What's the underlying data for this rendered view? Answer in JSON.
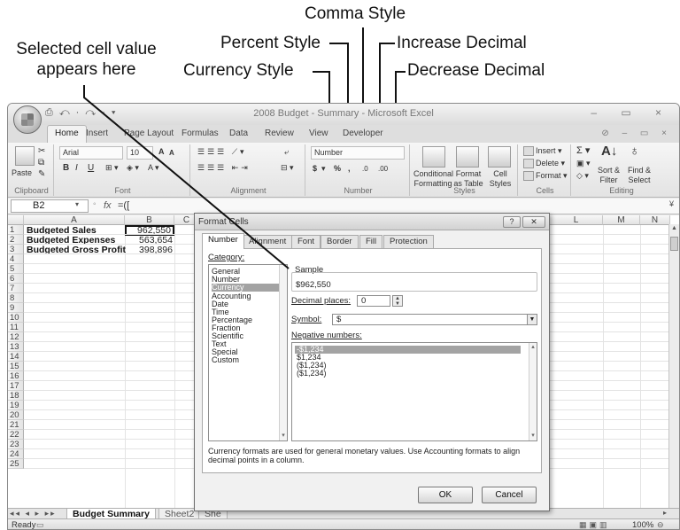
{
  "callouts": {
    "selected_cell": [
      "Selected cell value",
      "appears here"
    ],
    "comma_style": "Comma Style",
    "percent_style": "Percent Style",
    "increase_decimal": "Increase Decimal",
    "currency_style": "Currency Style",
    "decrease_decimal": "Decrease Decimal"
  },
  "window": {
    "title": "2008 Budget - Summary - Microsoft Excel",
    "quick_access": "⎙ ↶ · ↷ · ▾",
    "controls": "– ▭ ×",
    "help_controls": "⊘ – ▭ ×"
  },
  "tabs": [
    "Home",
    "Insert",
    "Page Layout",
    "Formulas",
    "Data",
    "Review",
    "View",
    "Developer"
  ],
  "ribbon": {
    "clipboard": {
      "label": "Clipboard",
      "paste": "Paste"
    },
    "font": {
      "label": "Font",
      "name": "Arial",
      "size": "10",
      "grow": "A",
      "shrink": "A",
      "bold": "B",
      "italic": "I",
      "underline": "U"
    },
    "alignment": {
      "label": "Alignment"
    },
    "number": {
      "label": "Number",
      "format": "Number",
      "currency": "$",
      "percent": "%",
      "comma": ",",
      "increase": ".0",
      "decrease": ".00"
    },
    "styles": {
      "label": "Styles",
      "conditional": [
        "Conditional",
        "Formatting"
      ],
      "format_table": [
        "Format",
        "as Table"
      ],
      "cell_styles": [
        "Cell",
        "Styles"
      ]
    },
    "cells": {
      "label": "Cells",
      "insert": "Insert",
      "delete": "Delete",
      "format": "Format"
    },
    "editing": {
      "label": "Editing",
      "sum": "Σ",
      "sort": [
        "Sort &",
        "Filter"
      ],
      "find": [
        "Find &",
        "Select"
      ]
    }
  },
  "formula_bar": {
    "name_box": "B2",
    "fx": "fx",
    "value": "=(["
  },
  "grid": {
    "columns": [
      "A",
      "B",
      "C",
      "L",
      "M",
      "N"
    ],
    "rows": [
      "1",
      "2",
      "3",
      "4",
      "5",
      "6",
      "7",
      "8",
      "9",
      "10",
      "11",
      "12",
      "13",
      "14",
      "15",
      "16",
      "17",
      "18",
      "19",
      "20",
      "21",
      "22",
      "23",
      "24",
      "25"
    ],
    "cells": [
      {
        "label": "Budgeted Sales",
        "value": "962,550"
      },
      {
        "label": "Budgeted Expenses",
        "value": "563,654"
      },
      {
        "label": "Budgeted Gross Profit",
        "value": "398,896"
      }
    ]
  },
  "sheet_tabs": {
    "nav": "◂◂ ◂ ▸ ▸▸",
    "tabs": [
      "Budget Summary",
      "Sheet2",
      "She"
    ]
  },
  "status": {
    "ready": "Ready",
    "zoom": "100%"
  },
  "dialog": {
    "title": "Format Cells",
    "help": "?",
    "close": "✕",
    "tabs": [
      "Number",
      "Alignment",
      "Font",
      "Border",
      "Fill",
      "Protection"
    ],
    "category_label": "Category:",
    "categories": [
      "General",
      "Number",
      "Currency",
      "Accounting",
      "Date",
      "Time",
      "Percentage",
      "Fraction",
      "Scientific",
      "Text",
      "Special",
      "Custom"
    ],
    "selected_category": "Currency",
    "sample_label": "Sample",
    "sample_value": "$962,550",
    "decimal_label": "Decimal places:",
    "decimal_value": "0",
    "symbol_label": "Symbol:",
    "symbol_value": "$",
    "negative_label": "Negative numbers:",
    "negative_options": [
      "-$1,234",
      "$1,234",
      "($1,234)",
      "($1,234)"
    ],
    "description": "Currency formats are used for general monetary values.  Use Accounting formats to align decimal points in a column.",
    "ok": "OK",
    "cancel": "Cancel"
  },
  "colors": {
    "accent": "#a3a3a3",
    "ribbon": "#e8e8e8",
    "border": "#8a8a8a"
  }
}
